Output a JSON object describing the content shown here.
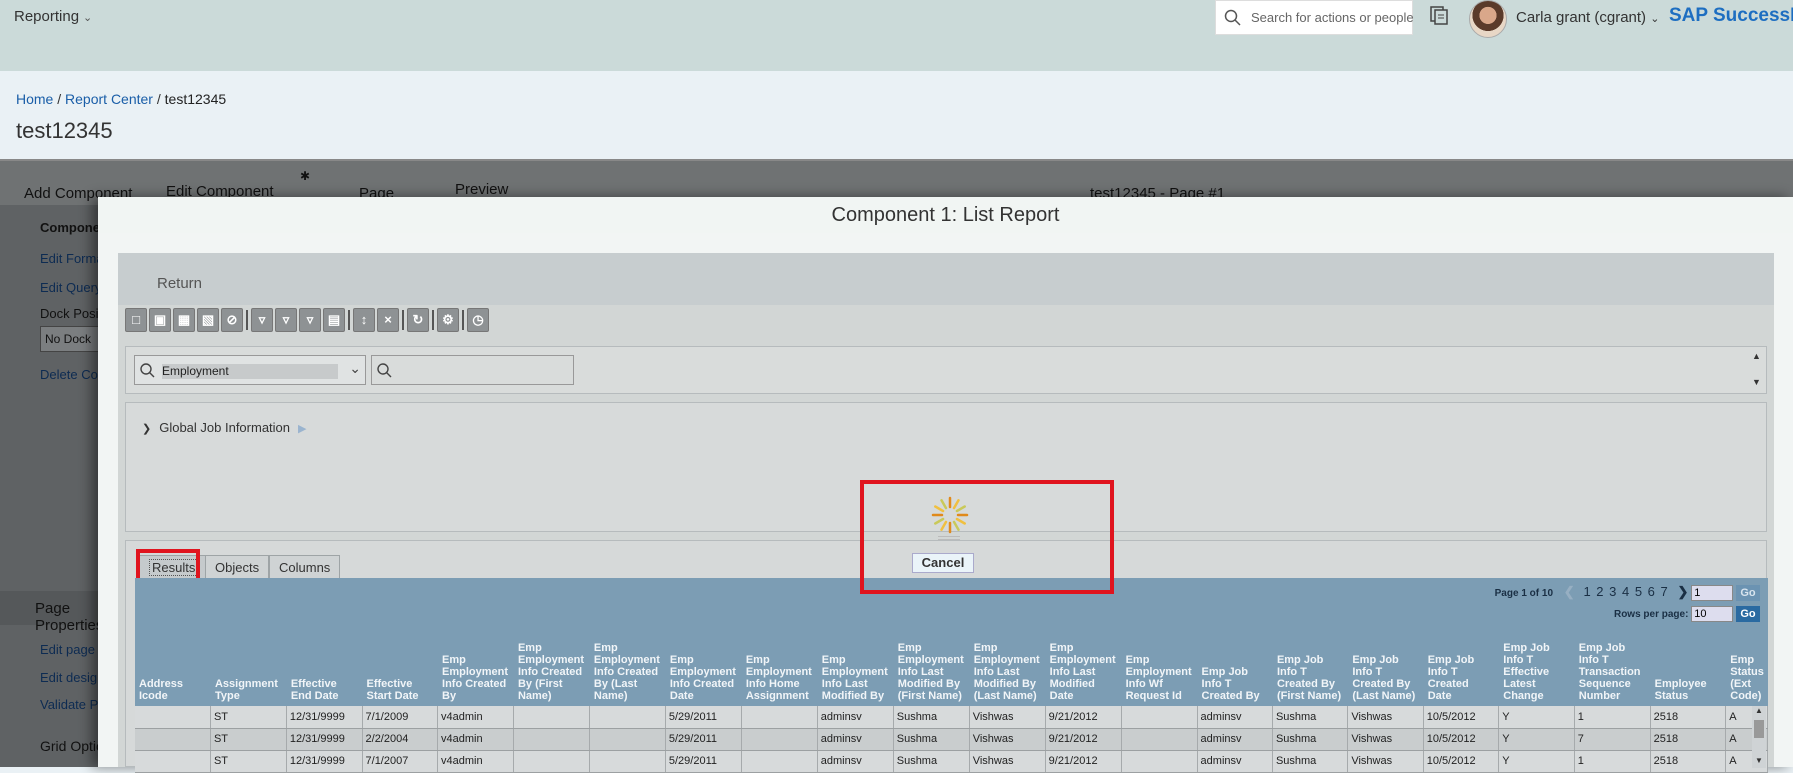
{
  "shell": {
    "module": "Reporting",
    "search_placeholder": "Search for actions or people",
    "user": "Carla grant (cgrant)",
    "brand": "SAP SuccessFactors"
  },
  "breadcrumb": {
    "home": "Home",
    "sep1": "/",
    "report_center": "Report Center",
    "sep2": "/",
    "current": "test12345"
  },
  "page_title": "test12345",
  "designer": {
    "tabs": {
      "add": "Add Component",
      "edit": "Edit Component",
      "page": "Page",
      "preview": "Preview",
      "page_name": "test12345 - Page #1"
    },
    "left": {
      "component": "Component",
      "edit_format": "Edit Format",
      "edit_query": "Edit Query",
      "dock": "Dock Position",
      "dock_value": "No Dock",
      "delete": "Delete Component"
    },
    "page_props": {
      "title": "Page Properties",
      "edit_page": "Edit page properties",
      "edit_design": "Edit design",
      "validate": "Validate Page",
      "grid": "Grid Options"
    }
  },
  "modal": {
    "title": "Component 1: List Report",
    "return_label": "Return",
    "domain_select": "Employment",
    "filter_item": "Global Job Information",
    "tabs": [
      "Results",
      "Objects",
      "Columns"
    ],
    "cancel_label": "Cancel",
    "pager": {
      "page_info": "Page 1 of 10",
      "pages": "1 2 3 4 5 6 7",
      "page_input": "1",
      "go": "Go",
      "rows_label": "Rows per page:",
      "rows_value": "10"
    },
    "columns": [
      "Address Icode",
      "Assignment Type",
      "Effective End Date",
      "Effective Start Date",
      "Emp Employment Info Created By",
      "Emp Employment Info Created By (First Name)",
      "Emp Employment Info Created By (Last Name)",
      "Emp Employment Info Created Date",
      "Emp Employment Info Home Assignment",
      "Emp Employment Info Last Modified By",
      "Emp Employment Info Last Modified By (First Name)",
      "Emp Employment Info Last Modified By (Last Name)",
      "Emp Employment Info Last Modified Date",
      "Emp Employment Info Wf Request Id",
      "Emp Job Info T Created By",
      "Emp Job Info T Created By (First Name)",
      "Emp Job Info T Created By (Last Name)",
      "Emp Job Info T Created Date",
      "Emp Job Info T Effective Latest Change",
      "Emp Job Info T Transaction Sequence Number",
      "Employee Status",
      "Emp Status (Ext Code)"
    ],
    "rows": [
      [
        "",
        "ST",
        "12/31/9999",
        "7/1/2009",
        "v4admin",
        "",
        "",
        "5/29/2011",
        "",
        "adminsv",
        "Sushma",
        "Vishwas",
        "9/21/2012",
        "",
        "adminsv",
        "Sushma",
        "Vishwas",
        "10/5/2012",
        "Y",
        "1",
        "2518",
        "A"
      ],
      [
        "",
        "ST",
        "12/31/9999",
        "2/2/2004",
        "v4admin",
        "",
        "",
        "5/29/2011",
        "",
        "adminsv",
        "Sushma",
        "Vishwas",
        "9/21/2012",
        "",
        "adminsv",
        "Sushma",
        "Vishwas",
        "10/5/2012",
        "Y",
        "7",
        "2518",
        "A"
      ],
      [
        "",
        "ST",
        "12/31/9999",
        "7/1/2007",
        "v4admin",
        "",
        "",
        "5/29/2011",
        "",
        "adminsv",
        "Sushma",
        "Vishwas",
        "9/21/2012",
        "",
        "adminsv",
        "Sushma",
        "Vishwas",
        "10/5/2012",
        "Y",
        "1",
        "2518",
        "A"
      ]
    ]
  },
  "colors": {
    "shell": "#cbdad9",
    "grid_header": "#7c9db4",
    "highlight": "#e0141e",
    "brand": "#1d6ec1"
  }
}
